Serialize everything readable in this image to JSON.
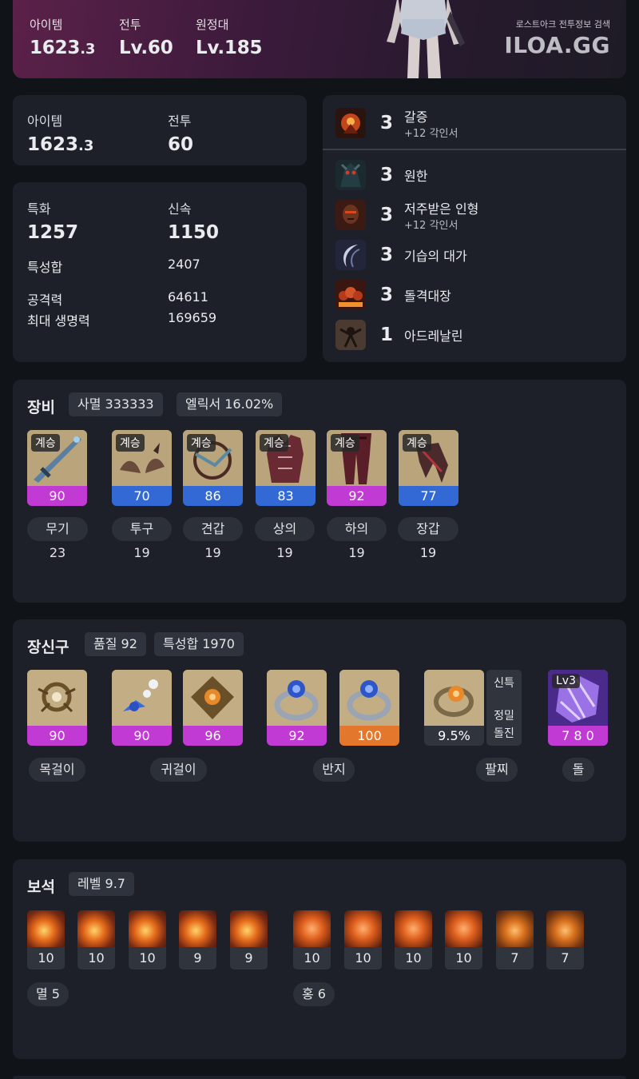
{
  "banner": {
    "stats": [
      {
        "label": "아이템",
        "value_main": "1623",
        "value_dec": ".3"
      },
      {
        "label": "전투",
        "value_main": "Lv.60",
        "value_dec": ""
      },
      {
        "label": "원정대",
        "value_main": "Lv.185",
        "value_dec": ""
      }
    ],
    "brand_sub": "로스트아크 전투정보 검색",
    "brand_logo": "ILOA.GG"
  },
  "levels_card": {
    "item_label": "아이템",
    "item_value_main": "1623",
    "item_value_dec": ".3",
    "combat_label": "전투",
    "combat_value": "60"
  },
  "stats_card": {
    "crit_label": "특화",
    "crit_value": "1257",
    "swift_label": "신속",
    "swift_value": "1150",
    "sum_label": "특성합",
    "sum_value": "2407",
    "atk_label": "공격력",
    "atk_value": "64611",
    "hp_label": "최대 생명력",
    "hp_value": "169659"
  },
  "engravings": [
    {
      "level": "3",
      "name": "갈증",
      "sub": "+12 각인서",
      "icon": "thirst-engraving-icon"
    },
    {
      "level": "3",
      "name": "원한",
      "sub": "",
      "icon": "grudge-engraving-icon"
    },
    {
      "level": "3",
      "name": "저주받은 인형",
      "sub": "+12 각인서",
      "icon": "cursed-doll-engraving-icon"
    },
    {
      "level": "3",
      "name": "기습의 대가",
      "sub": "",
      "icon": "ambush-master-engraving-icon"
    },
    {
      "level": "3",
      "name": "돌격대장",
      "sub": "",
      "icon": "raid-captain-engraving-icon"
    },
    {
      "level": "1",
      "name": "아드레날린",
      "sub": "",
      "icon": "adrenaline-engraving-icon"
    }
  ],
  "equipment": {
    "title": "장비",
    "pills": [
      "사멸 333333",
      "엘릭서 16.02%"
    ],
    "items": [
      {
        "tag": "계승",
        "quality": "90",
        "quality_color": "#c13ad3",
        "label": "무기 23",
        "icon": "weapon-icon"
      },
      {
        "tag": "계승",
        "quality": "70",
        "quality_color": "#3269d4",
        "label": "투구 19",
        "icon": "helmet-icon"
      },
      {
        "tag": "계승",
        "quality": "86",
        "quality_color": "#3269d4",
        "label": "견갑 19",
        "icon": "shoulder-icon"
      },
      {
        "tag": "계승",
        "quality": "83",
        "quality_color": "#3269d4",
        "label": "상의 19",
        "icon": "chest-armor-icon"
      },
      {
        "tag": "계승",
        "quality": "92",
        "quality_color": "#c13ad3",
        "label": "하의 19",
        "icon": "pants-icon"
      },
      {
        "tag": "계승",
        "quality": "77",
        "quality_color": "#3269d4",
        "label": "장갑 19",
        "icon": "gloves-icon"
      }
    ]
  },
  "accessories": {
    "title": "장신구",
    "pills": [
      "품질 92",
      "특성합 1970"
    ],
    "items": [
      {
        "quality": "90",
        "icon": "necklace-icon"
      },
      {
        "quality": "90",
        "icon": "earring-icon"
      },
      {
        "quality": "96",
        "icon": "earring-icon"
      },
      {
        "quality": "92",
        "icon": "ring-icon"
      },
      {
        "quality": "100",
        "icon": "ring-icon"
      },
      {
        "quality": "9.5%",
        "icon": "bracelet-icon"
      },
      {
        "quality": "7 8 0",
        "icon": "ability-stone-icon",
        "tag": "Lv3"
      }
    ],
    "bracelet_effects": [
      "신특",
      "정밀",
      "돌진"
    ],
    "labels": [
      "목걸이",
      "귀걸이",
      "반지",
      "팔찌",
      "돌"
    ]
  },
  "gems": {
    "title": "보석",
    "pill": "레벨 9.7",
    "annihilation": [
      "10",
      "10",
      "10",
      "9",
      "9"
    ],
    "crimson": [
      "10",
      "10",
      "10",
      "10",
      "7",
      "7"
    ],
    "annihilation_label": "멸 5",
    "crimson_label": "홍 6"
  },
  "colors": {
    "quality_purple": "#c13ad3",
    "quality_blue": "#3269d4",
    "quality_orange": "#e3772b",
    "card_bg": "#1d2028",
    "page_bg": "#101318"
  }
}
